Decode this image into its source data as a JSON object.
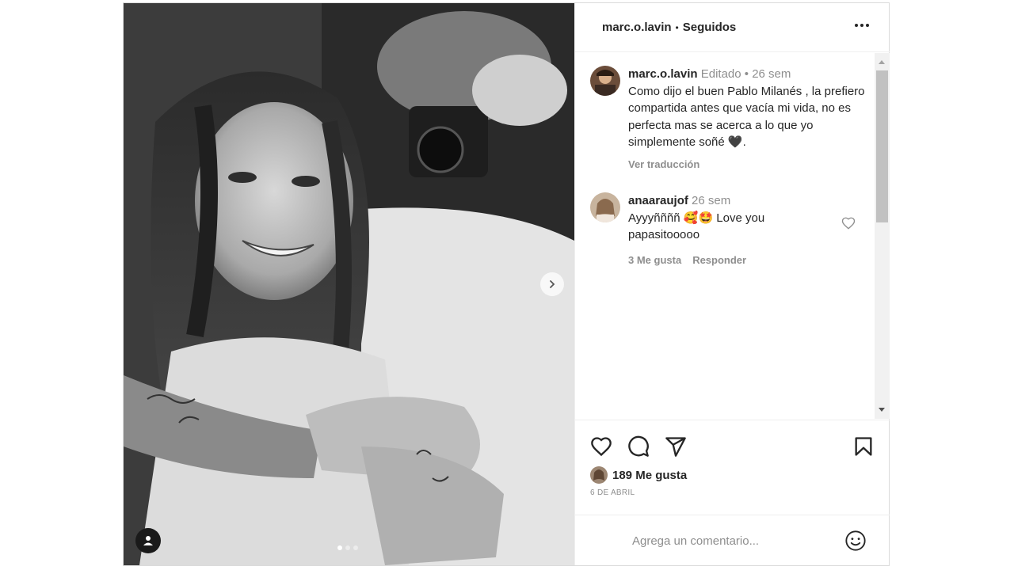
{
  "header": {
    "username": "marc.o.lavin",
    "separator": "•",
    "follow_status": "Seguidos"
  },
  "caption": {
    "username": "marc.o.lavin",
    "edited": "Editado",
    "dot": "•",
    "time": "26 sem",
    "text": "Como dijo el buen Pablo Milanés , la prefiero compartida antes que vacía mi vida, no es perfecta mas se acerca a lo que yo simplemente soñé 🖤.",
    "translate_label": "Ver traducción"
  },
  "comments": [
    {
      "username": "anaaraujof",
      "time": "26 sem",
      "text": "Ayyyññññ 🥰🤩 Love you papasitooooo",
      "likes_label": "3 Me gusta",
      "reply_label": "Responder"
    }
  ],
  "post": {
    "likes": "189 Me gusta",
    "date": "6 DE ABRIL",
    "comment_placeholder": "Agrega un comentario..."
  },
  "carousel": {
    "current": 1,
    "total": 3
  },
  "icons": [
    "heart-icon",
    "comment-icon",
    "share-icon",
    "bookmark-icon",
    "emoji-icon",
    "more-icon",
    "chevron-right-icon",
    "user-tag-icon"
  ]
}
